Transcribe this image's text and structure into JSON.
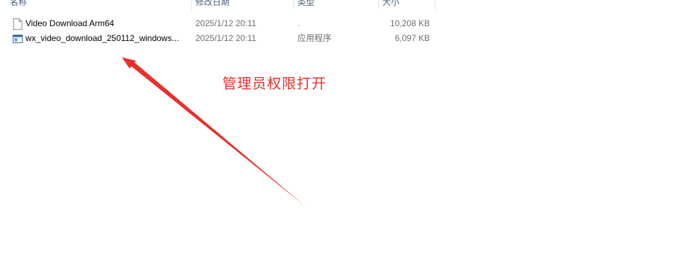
{
  "columns": {
    "name": "名称",
    "date": "修改日期",
    "type": "类型",
    "size": "大小"
  },
  "files": [
    {
      "name": "Video Download Arm64",
      "date": "2025/1/12 20:11",
      "type": ".",
      "size": "10,208 KB",
      "icon": "blank-file-icon"
    },
    {
      "name": "wx_video_download_250112_windows...",
      "date": "2025/1/12 20:11",
      "type": "应用程序",
      "size": "6,097 KB",
      "icon": "application-icon"
    }
  ],
  "annotation": {
    "text": "管理员权限打开",
    "color": "#e8302a"
  }
}
